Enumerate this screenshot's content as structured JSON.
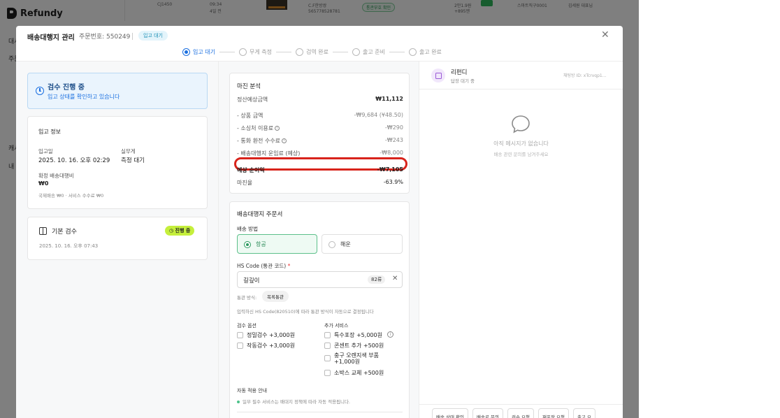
{
  "background": {
    "brand": "Refundy",
    "side_items": [
      "대시",
      "주문",
      "",
      "캐시",
      "내"
    ],
    "top_row": {
      "col1": "CJ1450",
      "col2": "09:34",
      "col3": "4일 전",
      "product_line1": "C.F한방쌍",
      "product_line2": "565778528781",
      "status_badge": "통관부호 확인",
      "price_1": "2만1.9원",
      "price_2": "+895엔",
      "store": "스마트직구0001",
      "extra": "김세원 대표님"
    }
  },
  "modal": {
    "title": "배송대행지 관리",
    "order_number": "주문번호: 550249",
    "status_badge": "입고 대기",
    "steps": [
      {
        "label": "입고 대기",
        "active": true
      },
      {
        "label": "무게 측정",
        "active": false
      },
      {
        "label": "검역 완료",
        "active": false
      },
      {
        "label": "출고 준비",
        "active": false
      },
      {
        "label": "출고 완료",
        "active": false
      }
    ]
  },
  "inspection": {
    "title": "검수 진행 중",
    "subtitle": "입고 상태를 확인하고 있습니다"
  },
  "receiving_info": {
    "title": "입고 정보",
    "date_label": "입고일",
    "date_value": "2025. 10. 16. 오후 02:29",
    "weight_label": "실무게",
    "weight_value": "측정 대기",
    "fee_label": "확정 배송대행비",
    "fee_value": "₩0",
    "fee_breakdown": "국제배송 ₩0 · 서비스 수수료 ₩0"
  },
  "basic_check": {
    "title": "기본 검수",
    "badge": "진행 중",
    "date": "2025. 10. 16. 오후 07:43"
  },
  "margin": {
    "title": "마진 분석",
    "rows": [
      {
        "label": "정산예상금액",
        "value": "₩11,112"
      },
      {
        "label": "- 상품 금액",
        "value": "-₩9,684 (¥48.50)"
      },
      {
        "label": "- 소싱처 이용료",
        "value": "-₩290"
      },
      {
        "label": "- 통화 환전 수수료",
        "value": "-₩243"
      },
      {
        "label": "- 배송대행지 운임료 (예상)",
        "value": "-₩8,000"
      },
      {
        "label": "예상 순이익",
        "value": "-₩7,105"
      },
      {
        "label": "마진율",
        "value": "-63.9%"
      }
    ],
    "highlight_color": "#d8231b"
  },
  "order_form": {
    "title": "배송대행지 주문서",
    "method_label": "배송 방법",
    "method_air": "항공",
    "method_sea": "해운",
    "hs_label": "HS Code (통관 코드)",
    "hs_required": "*",
    "hs_value": "길깊이",
    "hs_chip": "82류",
    "customs_label": "통관 방식:",
    "customs_value": "목록통관",
    "hs_note": "입력하신 HS Code(820510)에 따라 통관 방식이 자동으로 결정됩니다",
    "inspection_options_label": "검수 옵션",
    "inspection_options": [
      "정밀검수 +3,000원",
      "작동검수 +3,000원"
    ],
    "extra_services_label": "추가 서비스",
    "extra_services": [
      "특수포장 +5,000원",
      "콘센트 추가 +500원",
      "충구 오렌지색 부품 +1,000원",
      "소박스 교체 +500원"
    ],
    "auto_label": "자동 적용 안내",
    "auto_note": "일부 필수 서비스는 배대지 정책에 따라 자동 적용됩니다."
  },
  "chat": {
    "name": "리펀디",
    "sub": "답장 대기 중",
    "room_id": "채팅방 ID: xTcrvqp1...",
    "empty_title": "아직 메시지가 없습니다",
    "empty_sub": "배송 관련 문의를 남겨주세요",
    "quick_buttons": [
      "배송 상태 확인",
      "배송료 문의",
      "검수 요청",
      "재포장 요청",
      "출고 요"
    ]
  },
  "colors": {
    "accent_blue": "#1a6fe0",
    "progress_green": "#c5ef3c",
    "selected_green": "#2a9a5e"
  }
}
